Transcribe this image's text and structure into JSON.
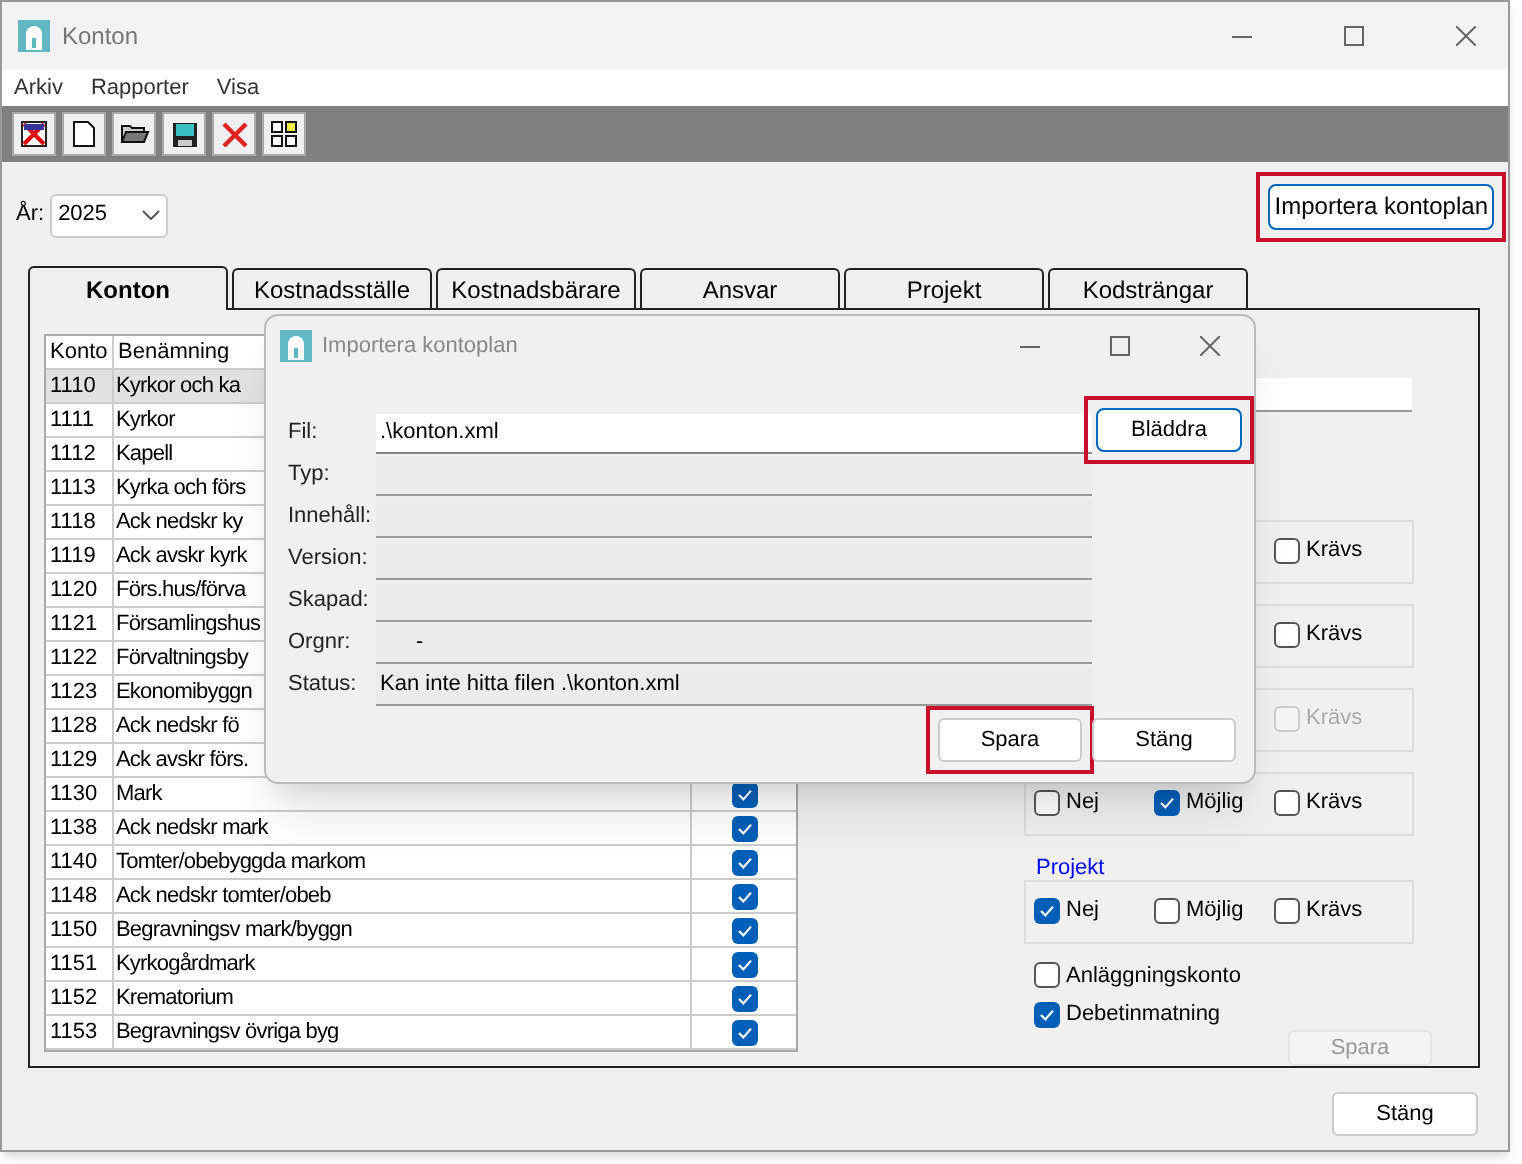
{
  "window": {
    "title": "Konton",
    "menu": [
      "Arkiv",
      "Rapporter",
      "Visa"
    ]
  },
  "year": {
    "label": "År:",
    "value": "2025"
  },
  "import_button": {
    "label": "Importera kontoplan",
    "highlighted": true
  },
  "tabs": [
    {
      "label": "Konton",
      "selected": true
    },
    {
      "label": "Kostnadsställe",
      "selected": false
    },
    {
      "label": "Kostnadsbärare",
      "selected": false
    },
    {
      "label": "Ansvar",
      "selected": false
    },
    {
      "label": "Projekt",
      "selected": false
    },
    {
      "label": "Kodsträngar",
      "selected": false
    }
  ],
  "table": {
    "columns": [
      "Konto",
      "Benämning"
    ],
    "rows": [
      {
        "konto": "1110",
        "name": "Kyrkor och ka",
        "selected": true
      },
      {
        "konto": "1111",
        "name": "Kyrkor",
        "selected": false
      },
      {
        "konto": "1112",
        "name": "Kapell",
        "selected": false
      },
      {
        "konto": "1113",
        "name": "Kyrka och förs",
        "selected": false
      },
      {
        "konto": "1118",
        "name": "Ack nedskr ky",
        "selected": false
      },
      {
        "konto": "1119",
        "name": "Ack avskr kyrk",
        "selected": false
      },
      {
        "konto": "1120",
        "name": "Förs.hus/förva",
        "selected": false
      },
      {
        "konto": "1121",
        "name": "Församlingshus",
        "selected": false
      },
      {
        "konto": "1122",
        "name": "Förvaltningsby",
        "selected": false
      },
      {
        "konto": "1123",
        "name": "Ekonomibyggn",
        "selected": false
      },
      {
        "konto": "1128",
        "name": "Ack nedskr fö",
        "selected": false
      },
      {
        "konto": "1129",
        "name": "Ack avskr förs.",
        "selected": false
      },
      {
        "konto": "1130",
        "name": "Mark",
        "selected": false,
        "checked": true
      },
      {
        "konto": "1138",
        "name": "Ack nedskr mark",
        "selected": false,
        "checked": true
      },
      {
        "konto": "1140",
        "name": "Tomter/obebyggda markom",
        "selected": false,
        "checked": true
      },
      {
        "konto": "1148",
        "name": "Ack nedskr tomter/obeb",
        "selected": false,
        "checked": true
      },
      {
        "konto": "1150",
        "name": "Begravningsv mark/byggn",
        "selected": false,
        "checked": true
      },
      {
        "konto": "1151",
        "name": "Kyrkogårdmark",
        "selected": false,
        "checked": true
      },
      {
        "konto": "1152",
        "name": "Krematorium",
        "selected": false,
        "checked": true
      },
      {
        "konto": "1153",
        "name": "Begravningsv övriga byg",
        "selected": false,
        "checked": true
      }
    ]
  },
  "right_panel": {
    "groups": [
      {
        "options": [
          {
            "label": "Krävs",
            "checked": false,
            "disabled": false
          }
        ]
      },
      {
        "options": [
          {
            "label": "Krävs",
            "checked": false,
            "disabled": false
          }
        ]
      },
      {
        "options": [
          {
            "label": "Krävs",
            "checked": false,
            "disabled": true
          }
        ]
      },
      {
        "options": [
          {
            "label": "Nej",
            "checked": false,
            "disabled": false
          },
          {
            "label": "Möjlig",
            "checked": true,
            "disabled": false
          },
          {
            "label": "Krävs",
            "checked": false,
            "disabled": false
          }
        ]
      },
      {
        "label": "Projekt",
        "options": [
          {
            "label": "Nej",
            "checked": true,
            "disabled": false
          },
          {
            "label": "Möjlig",
            "checked": false,
            "disabled": false
          },
          {
            "label": "Krävs",
            "checked": false,
            "disabled": false
          }
        ]
      }
    ],
    "flags": [
      {
        "label": "Anläggningskonto",
        "checked": false
      },
      {
        "label": "Debetinmatning",
        "checked": true
      }
    ],
    "save_button": {
      "label": "Spara",
      "disabled": true
    }
  },
  "close_button": {
    "label": "Stäng"
  },
  "dialog": {
    "title": "Importera kontoplan",
    "fields": [
      {
        "label": "Fil:",
        "kind": "input",
        "value": ".\\konton.xml"
      },
      {
        "label": "Typ:",
        "kind": "readonly"
      },
      {
        "label": "Innehåll:",
        "kind": "readonly"
      },
      {
        "label": "Version:",
        "kind": "readonly"
      },
      {
        "label": "Skapad:",
        "kind": "readonly"
      },
      {
        "label": "Orgnr:",
        "kind": "readonly",
        "value": "-"
      },
      {
        "label": "Status:",
        "kind": "readonly",
        "value": "Kan inte hitta filen .\\konton.xml"
      }
    ],
    "browse_button": {
      "label": "Bläddra",
      "highlighted": true
    },
    "buttons": [
      {
        "label": "Spara",
        "highlighted": true
      },
      {
        "label": "Stäng",
        "highlighted": false
      }
    ]
  }
}
